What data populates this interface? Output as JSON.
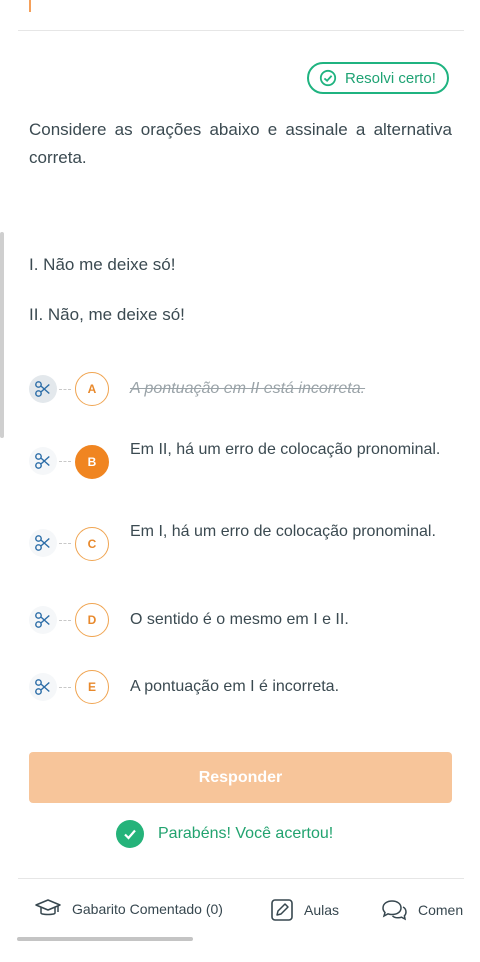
{
  "badge": {
    "label": "Resolvi certo!"
  },
  "question": {
    "prompt": "Considere as orações abaixo e assinale a alternativa correta.",
    "statements": [
      "I. Não me deixe só!",
      "II. Não, me deixe só!"
    ]
  },
  "alternatives": [
    {
      "letter": "A",
      "text": "A pontuação em II está incorreta.",
      "state": "eliminated"
    },
    {
      "letter": "B",
      "text": "Em II, há um erro de colocação pronominal.",
      "state": "selected"
    },
    {
      "letter": "C",
      "text": "Em I, há um erro de colocação pronominal.",
      "state": "default"
    },
    {
      "letter": "D",
      "text": "O sentido é o mesmo em I e II.",
      "state": "default"
    },
    {
      "letter": "E",
      "text": "A pontuação em I é incorreta.",
      "state": "default"
    }
  ],
  "answer_button": {
    "label": "Responder"
  },
  "feedback": {
    "message": "Parabéns! Você acertou!"
  },
  "bottom_tabs": [
    {
      "label": "Gabarito Comentado (0)",
      "icon": "graduation-cap-icon"
    },
    {
      "label": "Aulas",
      "icon": "edit-icon"
    },
    {
      "label": "Comen",
      "icon": "chat-icon"
    }
  ],
  "colors": {
    "accent": "#f08521",
    "success": "#1fb380",
    "button_disabled": "#f7c59a"
  }
}
